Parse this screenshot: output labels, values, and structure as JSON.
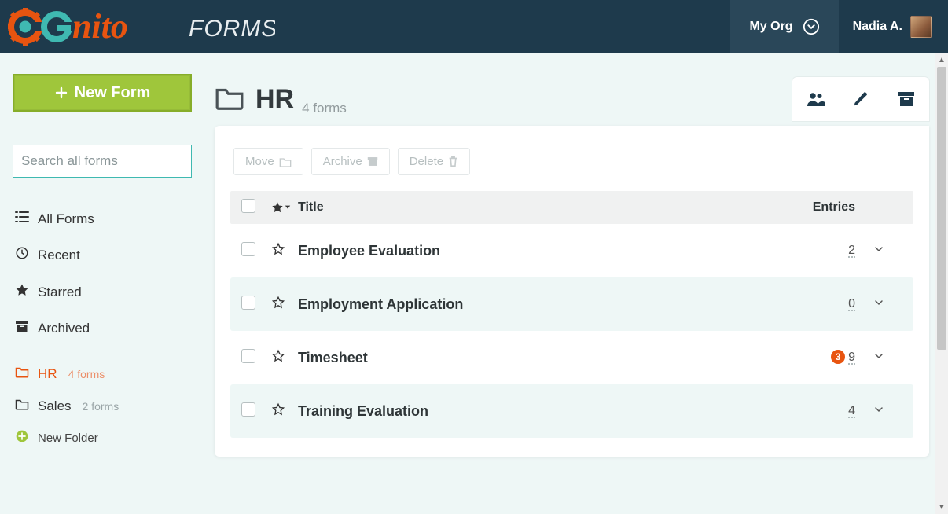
{
  "nav": {
    "brand_text": "FORMS",
    "org_label": "My Org",
    "user_name": "Nadia A."
  },
  "sidebar": {
    "new_form_label": "New Form",
    "search_placeholder": "Search all forms",
    "items": [
      {
        "icon": "list",
        "label": "All Forms"
      },
      {
        "icon": "clock",
        "label": "Recent"
      },
      {
        "icon": "star-fill",
        "label": "Starred"
      },
      {
        "icon": "archive",
        "label": "Archived"
      }
    ],
    "folders": [
      {
        "label": "HR",
        "count_label": "4 forms",
        "active": true
      },
      {
        "label": "Sales",
        "count_label": "2 forms",
        "active": false
      }
    ],
    "new_folder_label": "New Folder"
  },
  "content": {
    "title": "HR",
    "subtitle": "4 forms",
    "bulk": {
      "move_label": "Move",
      "archive_label": "Archive",
      "delete_label": "Delete"
    },
    "columns": {
      "title": "Title",
      "entries": "Entries"
    },
    "rows": [
      {
        "title": "Employee Evaluation",
        "entries": "2",
        "badge": null
      },
      {
        "title": "Employment Application",
        "entries": "0",
        "badge": null
      },
      {
        "title": "Timesheet",
        "entries": "9",
        "badge": "3"
      },
      {
        "title": "Training Evaluation",
        "entries": "4",
        "badge": null
      }
    ]
  }
}
